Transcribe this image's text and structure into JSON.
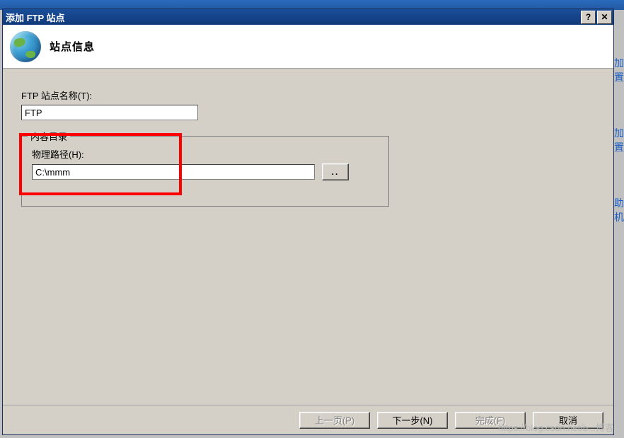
{
  "titlebar": {
    "title": "添加 FTP 站点",
    "help_label": "?",
    "close_label": "✕"
  },
  "banner": {
    "heading": "站点信息"
  },
  "form": {
    "site_name_label": "FTP 站点名称(T):",
    "site_name_value": "FTP",
    "group_legend": "内容目录",
    "path_label": "物理路径(H):",
    "path_value": "C:\\mmm",
    "browse_label": ".."
  },
  "buttons": {
    "prev": "上一页(P)",
    "next": "下一步(N)",
    "finish": "完成(F)",
    "cancel": "取消"
  },
  "watermark": "https://blog.csdn.net/b...博客",
  "side_text": [
    "加置",
    "加置",
    "助机"
  ]
}
